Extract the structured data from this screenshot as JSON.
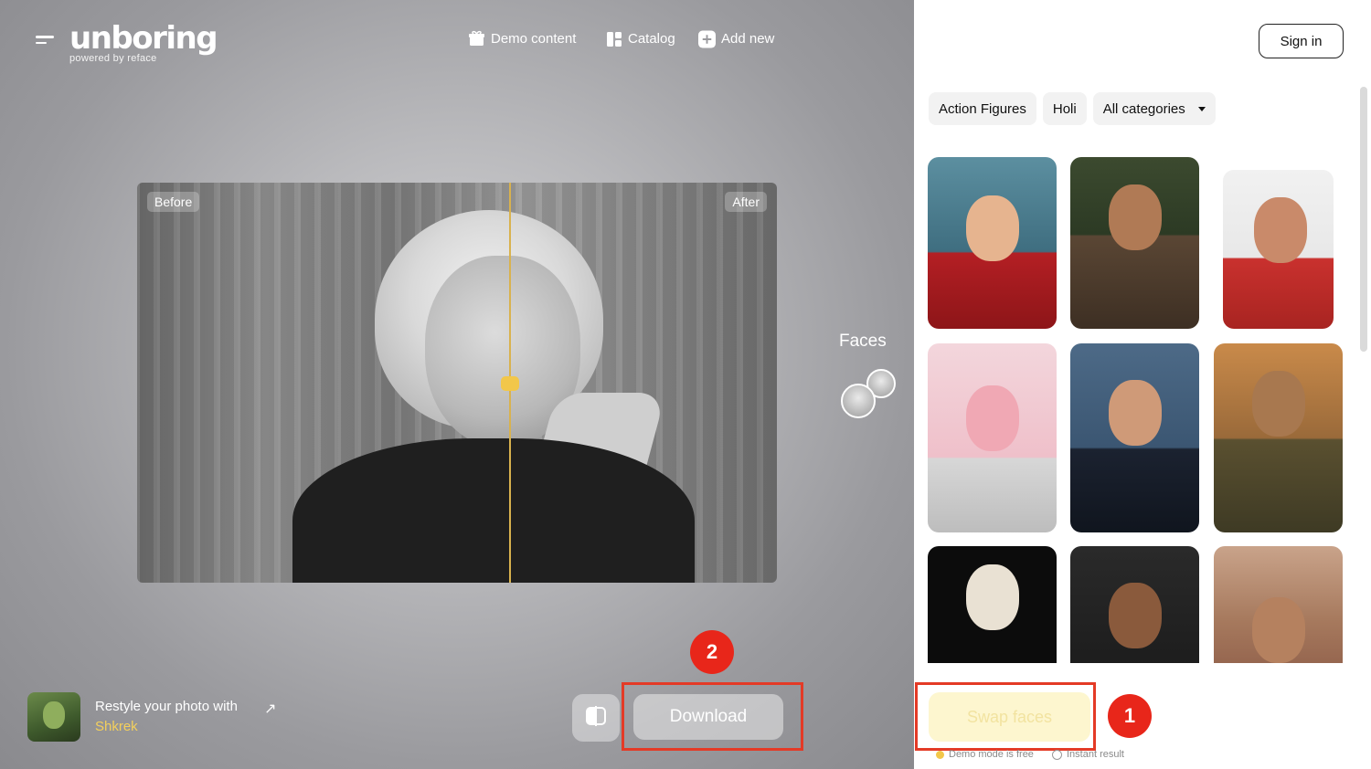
{
  "app": {
    "logo": "unboring",
    "logo_sub": "powered by reface"
  },
  "nav": {
    "demo": "Demo content",
    "catalog": "Catalog",
    "add": "Add new"
  },
  "compare": {
    "before": "Before",
    "after": "After"
  },
  "faces": {
    "label": "Faces"
  },
  "restyle": {
    "text": "Restyle your photo with",
    "link": "Shkrek"
  },
  "actions": {
    "download": "Download",
    "swap": "Swap faces"
  },
  "badges": {
    "one": "1",
    "two": "2"
  },
  "panel": {
    "signin": "Sign in",
    "categories": [
      "Action Figures",
      "Holi",
      "All categories"
    ],
    "footer": {
      "demo": "Demo mode is free",
      "instant": "Instant result"
    }
  },
  "colors": {
    "accent": "#f2c74a",
    "highlight": "#e43a26",
    "badge": "#e8261a"
  }
}
